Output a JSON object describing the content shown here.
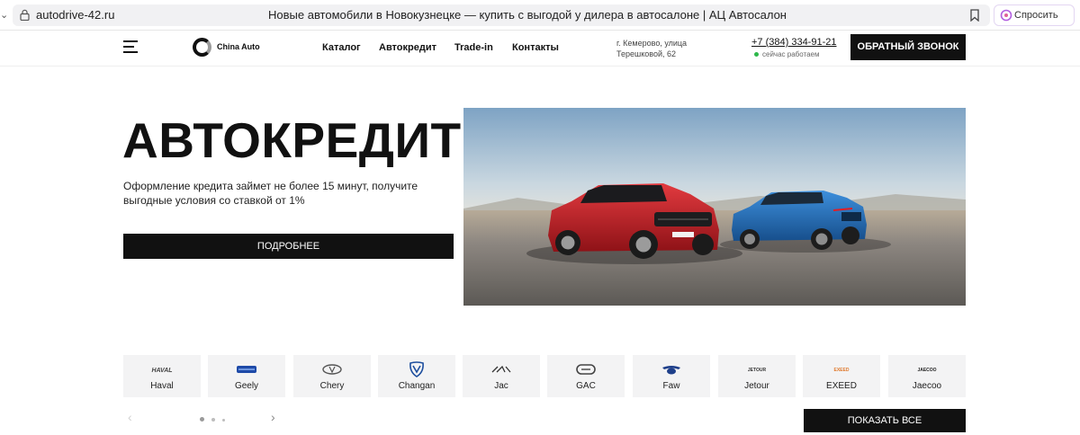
{
  "browser": {
    "url": "autodrive-42.ru",
    "tab_title": "Новые автомобили в Новокузнецке — купить с выгодой у дилера в автосалоне | АЦ Автосалон",
    "ask_label": "Спросить"
  },
  "header": {
    "logo_text": "China Auto",
    "nav": [
      "Каталог",
      "Автокредит",
      "Trade-in",
      "Контакты"
    ],
    "address_line1": "г. Кемерово, улица",
    "address_line2": "Терешковой, 62",
    "phone": "+7 (384) 334-91-21",
    "status": "сейчас работаем",
    "callback_label": "ОБРАТНЫЙ ЗВОНОК"
  },
  "hero": {
    "title": "АВТОКРЕДИТ",
    "subtitle": "Оформление кредита займет не более 15 минут, получите выгодные условия со ставкой от 1%",
    "button_label": "ПОДРОБНЕЕ"
  },
  "brands": {
    "items": [
      {
        "name": "Haval",
        "icon": "haval-logo-icon"
      },
      {
        "name": "Geely",
        "icon": "geely-logo-icon"
      },
      {
        "name": "Chery",
        "icon": "chery-logo-icon"
      },
      {
        "name": "Changan",
        "icon": "changan-logo-icon"
      },
      {
        "name": "Jac",
        "icon": "jac-logo-icon"
      },
      {
        "name": "GAC",
        "icon": "gac-logo-icon"
      },
      {
        "name": "Faw",
        "icon": "faw-logo-icon"
      },
      {
        "name": "Jetour",
        "icon": "jetour-logo-icon"
      },
      {
        "name": "EXEED",
        "icon": "exeed-logo-icon"
      },
      {
        "name": "Jaecoo",
        "icon": "jaecoo-logo-icon"
      }
    ],
    "show_all_label": "ПОКАЗАТЬ ВСЕ",
    "pager": {
      "pages": 3,
      "current": 1
    }
  },
  "colors": {
    "primary": "#111111",
    "card_bg": "#f3f3f4",
    "status_green": "#2eb84b",
    "car_red": "#c8202a",
    "car_blue": "#1f73c4"
  }
}
